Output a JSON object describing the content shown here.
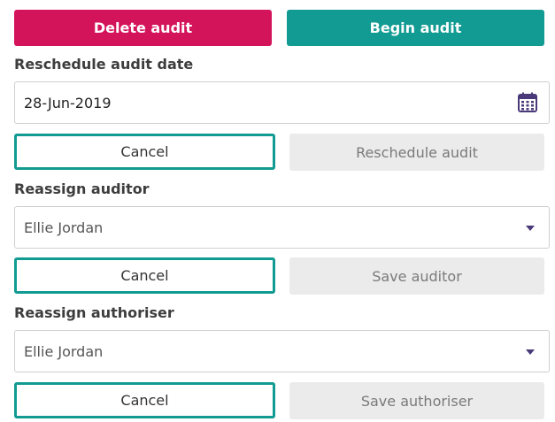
{
  "actions": {
    "delete_label": "Delete audit",
    "begin_label": "Begin audit"
  },
  "reschedule": {
    "label": "Reschedule audit date",
    "date_value": "28-Jun-2019",
    "cancel_label": "Cancel",
    "submit_label": "Reschedule audit"
  },
  "auditor": {
    "label": "Reassign auditor",
    "selected": "Ellie Jordan",
    "cancel_label": "Cancel",
    "submit_label": "Save auditor"
  },
  "authoriser": {
    "label": "Reassign authoriser",
    "selected": "Ellie Jordan",
    "cancel_label": "Cancel",
    "submit_label": "Save authoriser"
  },
  "icons": {
    "calendar": "calendar-icon",
    "dropdown": "chevron-down-icon"
  },
  "colors": {
    "delete": "#d4145a",
    "begin": "#119b92",
    "accent_border": "#119b92",
    "disabled_bg": "#ebebeb",
    "icon": "#4a3a7a"
  }
}
